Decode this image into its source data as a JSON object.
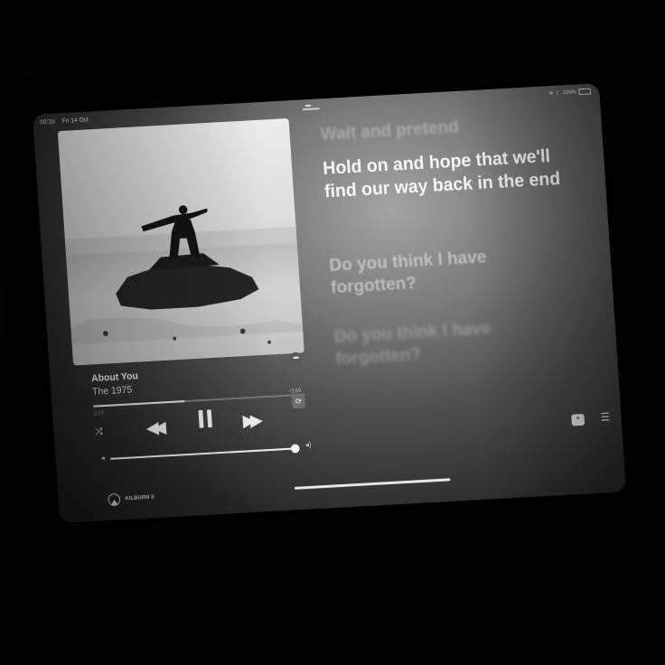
{
  "status_bar": {
    "time": "00:16",
    "date": "Fri 14 Oct",
    "battery": "100%"
  },
  "now_playing": {
    "title": "About You",
    "artist": "The 1975",
    "elapsed": "2:17",
    "remaining": "−3:09",
    "progress_fraction": 0.43,
    "volume_fraction": 0.98
  },
  "lyrics": {
    "past": "Wait and pretend",
    "current": "Hold on and hope that we'll find our way back in the end",
    "next": "Do you think I have forgotten?",
    "later": "Do you think I have forgotten?"
  },
  "output_device": {
    "name": "KILBURN II"
  },
  "icons": {
    "more": "more-icon",
    "shuffle": "shuffle-icon",
    "rewind": "rewind-icon",
    "pause": "pause-icon",
    "forward": "fast-forward-icon",
    "repeat": "repeat-icon",
    "airplay": "airplay-icon",
    "lyrics": "lyrics-icon",
    "queue": "queue-icon"
  },
  "colors": {
    "accent": "#f4f4f4",
    "screen_glow": "#a4a4a4",
    "background": "#030303"
  }
}
